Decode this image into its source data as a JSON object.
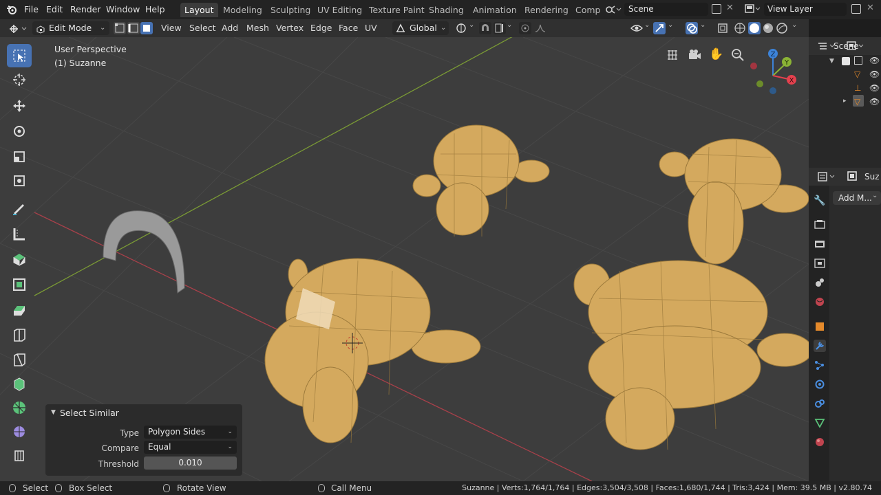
{
  "menubar": {
    "items": [
      "File",
      "Edit",
      "Render",
      "Window",
      "Help"
    ],
    "workspaces": [
      "Layout",
      "Modeling",
      "Sculpting",
      "UV Editing",
      "Texture Paint",
      "Shading",
      "Animation",
      "Rendering",
      "Comp"
    ],
    "active_workspace": "Layout",
    "scene_name": "Scene",
    "view_layer": "View Layer"
  },
  "header": {
    "mode": "Edit Mode",
    "menus": [
      "View",
      "Select",
      "Add",
      "Mesh",
      "Vertex",
      "Edge",
      "Face",
      "UV"
    ],
    "orientation": "Global"
  },
  "viewport": {
    "perspective_label": "User Perspective",
    "object_label": "(1) Suzanne",
    "gizmo_axes": [
      "Z",
      "Y",
      "X"
    ]
  },
  "operator_panel": {
    "title": "Select Similar",
    "rows": [
      {
        "label": "Type",
        "value": "Polygon Sides"
      },
      {
        "label": "Compare",
        "value": "Equal"
      },
      {
        "label": "Threshold",
        "value": "0.010"
      }
    ]
  },
  "outliner": {
    "root": "Scene"
  },
  "properties": {
    "object_label": "Suz",
    "add_modifier": "Add M..."
  },
  "statusbar": {
    "select": "Select",
    "box_select": "Box Select",
    "rotate_view": "Rotate View",
    "call_menu": "Call Menu",
    "stats": "Suzanne | Verts:1,764/1,764 | Edges:3,504/3,508 | Faces:1,680/1,744 | Tris:3,424 | Mem: 39.5 MB | v2.80.74"
  },
  "colors": {
    "accent": "#4772b3",
    "mesh": "#d4a95e",
    "x_axis": "#e6414e",
    "y_axis": "#8bb335",
    "z_axis": "#3d83d8"
  }
}
